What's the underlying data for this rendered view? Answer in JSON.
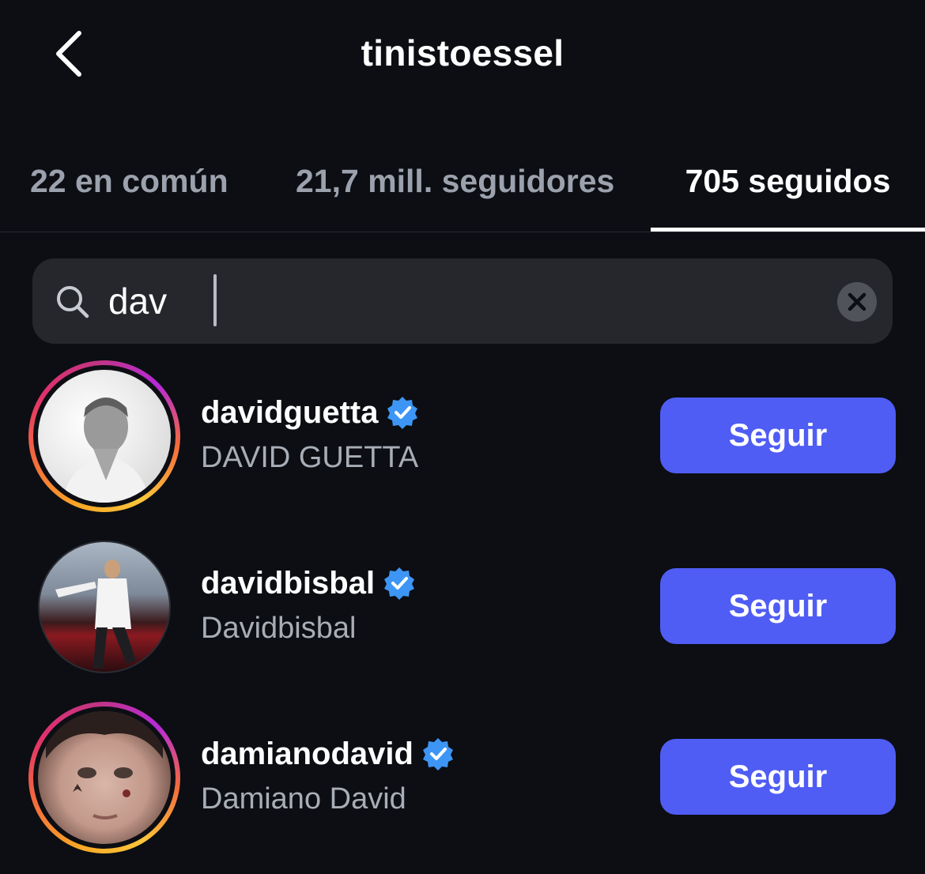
{
  "header": {
    "title": "tinistoessel",
    "back_icon": "chevron-left-icon"
  },
  "tabs": [
    {
      "label": "22 en común",
      "active": false
    },
    {
      "label": "21,7 mill. seguidores",
      "active": false
    },
    {
      "label": "705 seguidos",
      "active": true
    }
  ],
  "search": {
    "value": "dav",
    "search_icon": "search-icon",
    "clear_icon": "close-circle-icon"
  },
  "results": [
    {
      "username": "davidguetta",
      "full_name": "DAVID GUETTA",
      "verified": true,
      "story_ring": true,
      "button": "Seguir"
    },
    {
      "username": "davidbisbal",
      "full_name": "Davidbisbal",
      "verified": true,
      "story_ring": false,
      "button": "Seguir"
    },
    {
      "username": "damianodavid",
      "full_name": "Damiano David",
      "verified": true,
      "story_ring": true,
      "button": "Seguir"
    }
  ],
  "colors": {
    "background": "#0c0e13",
    "search_bg": "#25272d",
    "follow_button": "#4f5df4",
    "verified_badge": "#3d96f5",
    "muted_text": "#a8adb6"
  }
}
